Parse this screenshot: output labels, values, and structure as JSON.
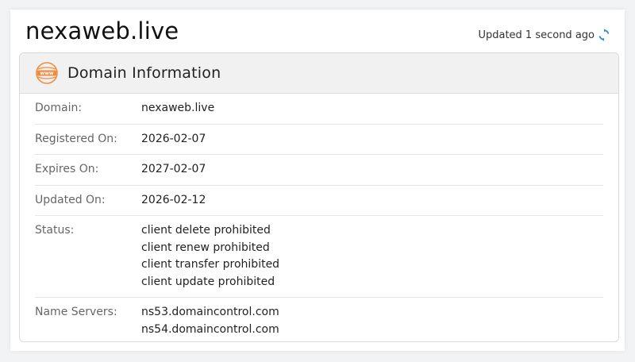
{
  "header": {
    "domain": "nexaweb.live",
    "updated_text": "Updated 1 second ago",
    "refresh_icon": "refresh-icon"
  },
  "card": {
    "icon": "www-globe-icon",
    "title": "Domain Information",
    "rows": [
      {
        "label": "Domain:",
        "values": [
          "nexaweb.live"
        ]
      },
      {
        "label": "Registered On:",
        "values": [
          "2026-02-07"
        ]
      },
      {
        "label": "Expires On:",
        "values": [
          "2027-02-07"
        ]
      },
      {
        "label": "Updated On:",
        "values": [
          "2026-02-12"
        ]
      },
      {
        "label": "Status:",
        "values": [
          "client delete prohibited",
          "client renew prohibited",
          "client transfer prohibited",
          "client update prohibited"
        ]
      },
      {
        "label": "Name Servers:",
        "values": [
          "ns53.domaincontrol.com",
          "ns54.domaincontrol.com"
        ]
      }
    ]
  },
  "colors": {
    "icon_orange": "#f28a3c",
    "refresh_blue": "#2b8ad8"
  }
}
